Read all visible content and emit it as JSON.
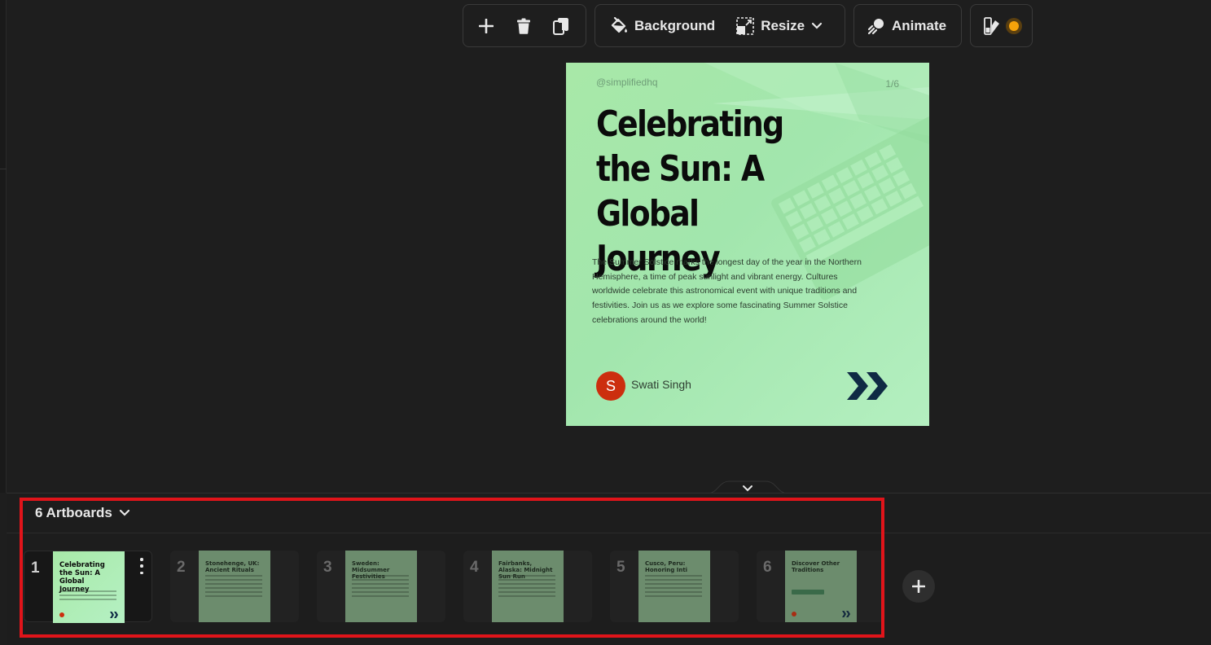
{
  "toolbar": {
    "add_label": "add",
    "delete_label": "delete",
    "duplicate_label": "duplicate",
    "background_label": "Background",
    "resize_label": "Resize",
    "animate_label": "Animate",
    "theme_accent": "#f5a20a"
  },
  "artboard": {
    "handle": "@simplifiedhq",
    "page_indicator": "1/6",
    "headline": "Celebrating the Sun: A Global Journey",
    "body": "The Summer Solstice marks the longest day of the year in the Northern Hemisphere, a time of peak sunlight and vibrant energy. Cultures worldwide celebrate this astronomical event with unique traditions and festivities. Join us as we explore some fascinating Summer Solstice celebrations around the world!",
    "author_initial": "S",
    "author_name": "Swati Singh",
    "colors": {
      "background": "#a8e8a8",
      "avatar": "#cc2e0e",
      "chevrons": "#0f2a44"
    }
  },
  "panel": {
    "artboards_label": "6 Artboards",
    "highlight_color": "#e0141a",
    "thumbnails": [
      {
        "number": "1",
        "title": "Celebrating the Sun: A Global Journey",
        "active": true
      },
      {
        "number": "2",
        "title": "Stonehenge, UK: Ancient Rituals",
        "active": false
      },
      {
        "number": "3",
        "title": "Sweden: Midsummer Festivities",
        "active": false
      },
      {
        "number": "4",
        "title": "Fairbanks, Alaska: Midnight Sun Run",
        "active": false
      },
      {
        "number": "5",
        "title": "Cusco, Peru: Honoring Inti",
        "active": false
      },
      {
        "number": "6",
        "title": "Discover Other Traditions",
        "active": false
      }
    ]
  }
}
